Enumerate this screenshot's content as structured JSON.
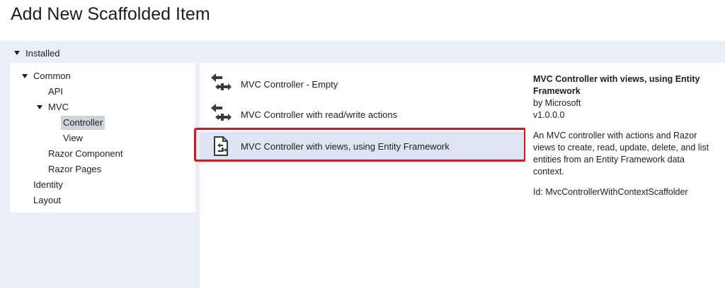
{
  "dialog": {
    "title": "Add New Scaffolded Item"
  },
  "installed": {
    "label": "Installed"
  },
  "tree": {
    "common": "Common",
    "api": "API",
    "mvc": "MVC",
    "controller": "Controller",
    "view": "View",
    "razor_component": "Razor Component",
    "razor_pages": "Razor Pages",
    "identity": "Identity",
    "layout": "Layout"
  },
  "templates": [
    {
      "label": "MVC Controller - Empty",
      "icon": "controller-icon"
    },
    {
      "label": "MVC Controller with read/write actions",
      "icon": "controller-icon"
    },
    {
      "label": "MVC Controller with views, using Entity Framework",
      "icon": "entity-framework-icon"
    }
  ],
  "details": {
    "title": "MVC Controller with views, using Entity Framework",
    "author": "by Microsoft",
    "version": "v1.0.0.0",
    "description": "An MVC controller with actions and Razor views to create, read, update, delete, and list entities from an Entity Framework data context.",
    "id": "Id: MvcControllerWithContextScaffolder"
  },
  "colors": {
    "background": "#e9eef8",
    "selected_item": "#dfe4f3",
    "highlight_border": "#e3121b"
  }
}
